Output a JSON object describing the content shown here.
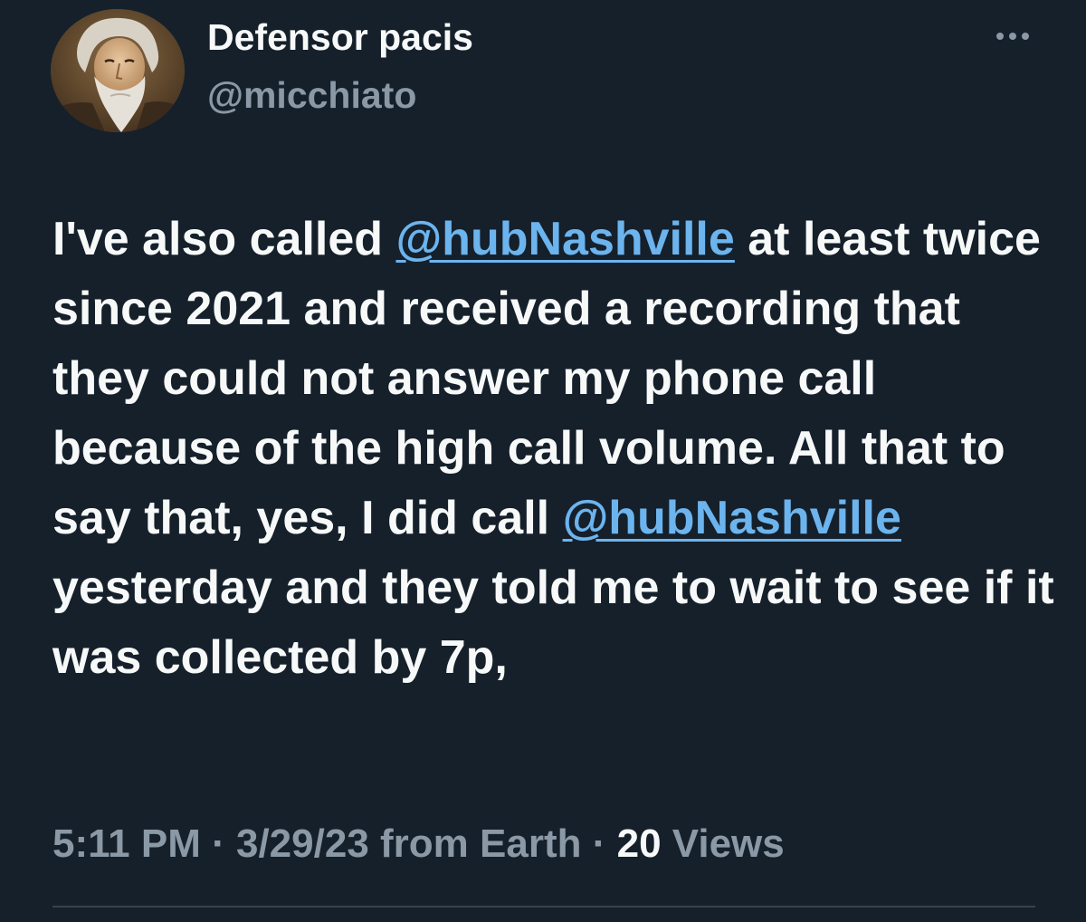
{
  "author": {
    "display_name": "Defensor pacis",
    "handle": "@micchiato",
    "avatar_icon": "bearded-man-portrait"
  },
  "more_icon": "more-horizontal-icon",
  "tweet": {
    "text_parts": [
      "I've also called ",
      "@hubNashville",
      " at least twice since 2021 and received a recording that they could not answer my phone call because of the high call volume. All that to say that, yes, I did call ",
      "@hubNashville",
      " yesterday and they told me to wait to see if it was collected by 7p,"
    ]
  },
  "meta": {
    "time": "5:11 PM",
    "separator": " · ",
    "date": "3/29/23",
    "source": " from Earth",
    "views_count": "20",
    "views_label": " Views"
  },
  "colors": {
    "background": "#15202b",
    "text": "#f7f9f9",
    "secondary_text": "#8b98a5",
    "link": "#6cb4ee",
    "divider": "#38444d"
  }
}
